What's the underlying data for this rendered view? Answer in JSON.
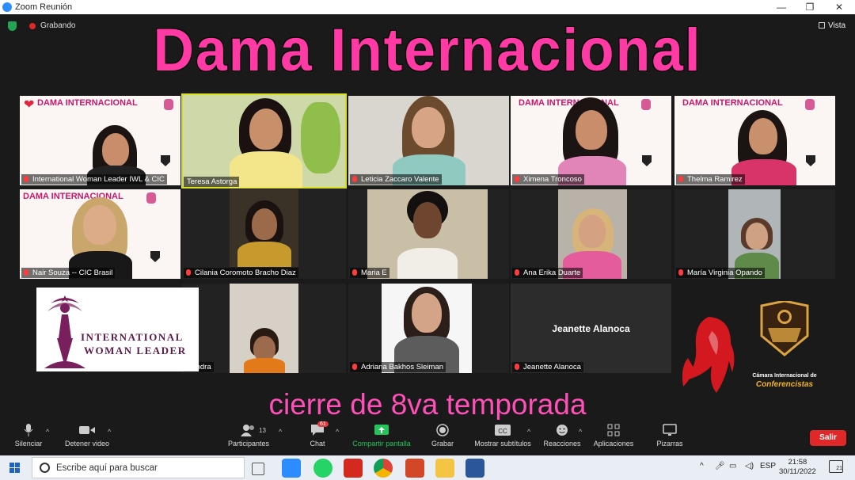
{
  "window": {
    "title": "Zoom Reunión",
    "minimize": "—",
    "restore": "❐",
    "close": "✕"
  },
  "meeting": {
    "recording_label": "Grabando",
    "view_label": "Vista"
  },
  "overlay": {
    "banner": "Dama Internacional",
    "subtitle": "cierre de 8va temporada"
  },
  "dama_slide": {
    "heading": "DAMA INTERNACIONAL"
  },
  "participants": [
    {
      "name": "International Woman Leader IWL & CIC"
    },
    {
      "name": "Teresa Astorga"
    },
    {
      "name": "Leticia Zaccaro Valente"
    },
    {
      "name": "Ximena Troncoso"
    },
    {
      "name": "Thelma Ramirez"
    },
    {
      "name": "Nair Souza -- CIC Brasil"
    },
    {
      "name": "Cilania Coromoto Bracho Diaz"
    },
    {
      "name": "Maria E"
    },
    {
      "name": "Ana Erika Duarte"
    },
    {
      "name": "María Virginia Opando"
    },
    {
      "name": "Sandra"
    },
    {
      "name": "Adriana Bakhos Sleiman"
    },
    {
      "name": "Jeanette Alanoca",
      "display": "Jeanette Alanoca"
    }
  ],
  "iwl_logo": {
    "line1": "INTERNATIONAL",
    "line2": "WOMAN LEADER"
  },
  "cic_logo": {
    "line1": "Cámara Internacional de",
    "line2": "Conferencistas"
  },
  "toolbar": {
    "mute": "Silenciar",
    "stop_video": "Detener video",
    "participants": "Participantes",
    "participants_count": "13",
    "chat": "Chat",
    "chat_badge": "61",
    "share": "Compartir pantalla",
    "record": "Grabar",
    "captions": "Mostrar subtítulos",
    "reactions": "Reacciones",
    "apps": "Aplicaciones",
    "whiteboards": "Pizarras",
    "leave": "Salir"
  },
  "taskbar": {
    "search_placeholder": "Escribe aquí para buscar",
    "language": "ESP",
    "time": "21:58",
    "date": "30/11/2022",
    "notifications": "21"
  },
  "colors": {
    "banner": "#ff3aa5",
    "subtitle": "#ff4fb8",
    "leave": "#e02828",
    "share": "#23c45a"
  }
}
